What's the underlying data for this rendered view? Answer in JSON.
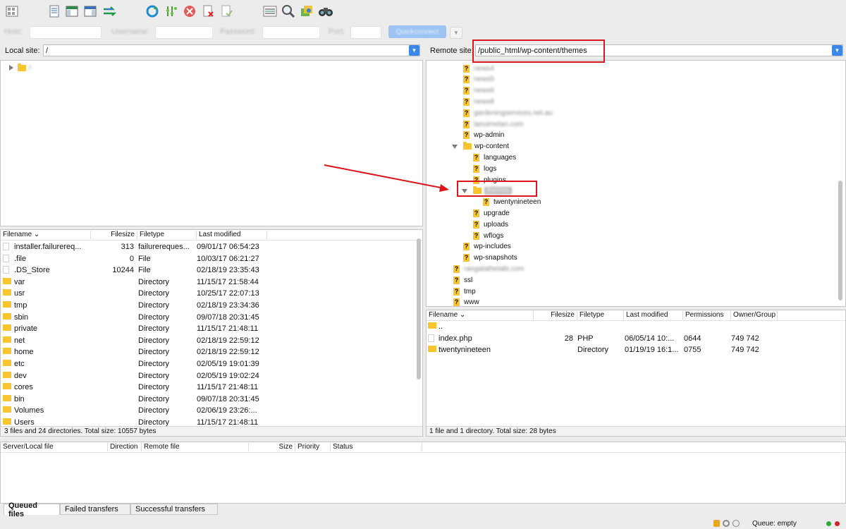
{
  "toolbar": {
    "icons": [
      "site-manager-icon",
      "message-log-icon",
      "local-tree-icon",
      "remote-tree-icon",
      "transfer-queue-icon",
      "refresh-icon",
      "process-queue-icon",
      "cancel-icon",
      "disconnect-icon",
      "reconnect-icon",
      "filter-icon",
      "compare-icon",
      "sync-browse-icon",
      "search-icon"
    ]
  },
  "quickconnect": {
    "host_label": "Host:",
    "username_label": "Username:",
    "password_label": "Password:",
    "port_label": "Port:",
    "button_label": "Quickconnect"
  },
  "local": {
    "label": "Local site:",
    "path": "/",
    "tree_root": "/",
    "columns": [
      "Filename",
      "Filesize",
      "Filetype",
      "Last modified"
    ],
    "files": [
      {
        "name": "installer.failurereq...",
        "size": "313",
        "type": "failurereques...",
        "modified": "09/01/17 06:54:23",
        "kind": "file"
      },
      {
        "name": ".file",
        "size": "0",
        "type": "File",
        "modified": "10/03/17 06:21:27",
        "kind": "file"
      },
      {
        "name": ".DS_Store",
        "size": "10244",
        "type": "File",
        "modified": "02/18/19 23:35:43",
        "kind": "file"
      },
      {
        "name": "var",
        "size": "",
        "type": "Directory",
        "modified": "11/15/17 21:58:44",
        "kind": "dir"
      },
      {
        "name": "usr",
        "size": "",
        "type": "Directory",
        "modified": "10/25/17 22:07:13",
        "kind": "dir"
      },
      {
        "name": "tmp",
        "size": "",
        "type": "Directory",
        "modified": "02/18/19 23:34:36",
        "kind": "dir"
      },
      {
        "name": "sbin",
        "size": "",
        "type": "Directory",
        "modified": "09/07/18 20:31:45",
        "kind": "dir"
      },
      {
        "name": "private",
        "size": "",
        "type": "Directory",
        "modified": "11/15/17 21:48:11",
        "kind": "dir"
      },
      {
        "name": "net",
        "size": "",
        "type": "Directory",
        "modified": "02/18/19 22:59:12",
        "kind": "dir"
      },
      {
        "name": "home",
        "size": "",
        "type": "Directory",
        "modified": "02/18/19 22:59:12",
        "kind": "dir"
      },
      {
        "name": "etc",
        "size": "",
        "type": "Directory",
        "modified": "02/05/19 19:01:39",
        "kind": "dir"
      },
      {
        "name": "dev",
        "size": "",
        "type": "Directory",
        "modified": "02/05/19 19:02:24",
        "kind": "dir"
      },
      {
        "name": "cores",
        "size": "",
        "type": "Directory",
        "modified": "11/15/17 21:48:11",
        "kind": "dir"
      },
      {
        "name": "bin",
        "size": "",
        "type": "Directory",
        "modified": "09/07/18 20:31:45",
        "kind": "dir"
      },
      {
        "name": "Volumes",
        "size": "",
        "type": "Directory",
        "modified": "02/06/19 23:26:...",
        "kind": "dir"
      },
      {
        "name": "Users",
        "size": "",
        "type": "Directory",
        "modified": "11/15/17 21:48:11",
        "kind": "dir"
      }
    ],
    "status": "3 files and 24 directories. Total size: 10557 bytes"
  },
  "remote": {
    "label": "Remote site:",
    "path": "/public_html/wp-content/themes",
    "tree": [
      {
        "label": "news4",
        "indent": 1,
        "icon": "q",
        "blur": true
      },
      {
        "label": "news5",
        "indent": 1,
        "icon": "q",
        "blur": true
      },
      {
        "label": "news6",
        "indent": 1,
        "icon": "q",
        "blur": true
      },
      {
        "label": "news8",
        "indent": 1,
        "icon": "q",
        "blur": true
      },
      {
        "label": "gardeningservices.net.au",
        "indent": 1,
        "icon": "q",
        "blur": true
      },
      {
        "label": "lanuimetan.com",
        "indent": 1,
        "icon": "q",
        "blur": true
      },
      {
        "label": "wp-admin",
        "indent": 1,
        "icon": "q",
        "blur": false
      },
      {
        "label": "wp-content",
        "indent": 1,
        "icon": "folder",
        "blur": false,
        "expanded": true
      },
      {
        "label": "languages",
        "indent": 2,
        "icon": "q",
        "blur": false
      },
      {
        "label": "logs",
        "indent": 2,
        "icon": "q",
        "blur": false
      },
      {
        "label": "plugins",
        "indent": 2,
        "icon": "q",
        "blur": false
      },
      {
        "label": "themes",
        "indent": 2,
        "icon": "folder",
        "blur": true,
        "expanded": true,
        "selected": true
      },
      {
        "label": "twentynineteen",
        "indent": 3,
        "icon": "q",
        "blur": false
      },
      {
        "label": "upgrade",
        "indent": 2,
        "icon": "q",
        "blur": false
      },
      {
        "label": "uploads",
        "indent": 2,
        "icon": "q",
        "blur": false
      },
      {
        "label": "wflogs",
        "indent": 2,
        "icon": "q",
        "blur": false
      },
      {
        "label": "wp-includes",
        "indent": 1,
        "icon": "q",
        "blur": false
      },
      {
        "label": "wp-snapshots",
        "indent": 1,
        "icon": "q",
        "blur": false
      },
      {
        "label": "rangatathetabi.com",
        "indent": 0,
        "icon": "q",
        "blur": true
      },
      {
        "label": "ssl",
        "indent": 0,
        "icon": "q",
        "blur": false
      },
      {
        "label": "tmp",
        "indent": 0,
        "icon": "q",
        "blur": false
      },
      {
        "label": "www",
        "indent": 0,
        "icon": "q",
        "blur": false
      }
    ],
    "columns": [
      "Filename",
      "Filesize",
      "Filetype",
      "Last modified",
      "Permissions",
      "Owner/Group"
    ],
    "files": [
      {
        "name": "..",
        "size": "",
        "type": "",
        "modified": "",
        "perms": "",
        "owner": "",
        "kind": "dir"
      },
      {
        "name": "index.php",
        "size": "28",
        "type": "PHP",
        "modified": "06/05/14 10:...",
        "perms": "0644",
        "owner": "749 742",
        "kind": "file"
      },
      {
        "name": "twentynineteen",
        "size": "",
        "type": "Directory",
        "modified": "01/19/19 16:1...",
        "perms": "0755",
        "owner": "749 742",
        "kind": "dir"
      }
    ],
    "status": "1 file and 1 directory. Total size: 28 bytes"
  },
  "queue": {
    "columns": [
      "Server/Local file",
      "Direction",
      "Remote file",
      "Size",
      "Priority",
      "Status"
    ],
    "tabs": [
      "Queued files",
      "Failed transfers",
      "Successful transfers"
    ],
    "status": "Queue: empty"
  },
  "colors": {
    "accent": "#3b86e8",
    "folder": "#f7c52f",
    "annotation": "#d8161b"
  }
}
